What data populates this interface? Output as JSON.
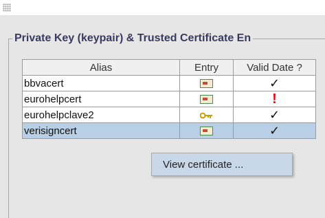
{
  "panel": {
    "title": "Private Key (keypair) & Trusted Certificate En"
  },
  "table": {
    "columns": [
      "Alias",
      "Entry",
      "Valid Date ?"
    ],
    "rows": [
      {
        "alias": "bbvacert",
        "entry_icon": "certificate-icon",
        "valid_icon": "checkmark-icon",
        "valid_symbol": "✓"
      },
      {
        "alias": "eurohelpcert",
        "entry_icon": "certificate-icon",
        "valid_icon": "warning-icon",
        "valid_symbol": "!"
      },
      {
        "alias": "eurohelpclave2",
        "entry_icon": "key-icon",
        "valid_icon": "checkmark-icon",
        "valid_symbol": "✓"
      },
      {
        "alias": "verisigncert",
        "entry_icon": "certificate-icon",
        "valid_icon": "checkmark-icon",
        "valid_symbol": "✓",
        "selected": true
      }
    ]
  },
  "context_menu": {
    "items": [
      "View certificate ..."
    ]
  },
  "colors": {
    "selection": "#b8cfe5",
    "title_text": "#3a3a60",
    "warning": "#d81010"
  }
}
